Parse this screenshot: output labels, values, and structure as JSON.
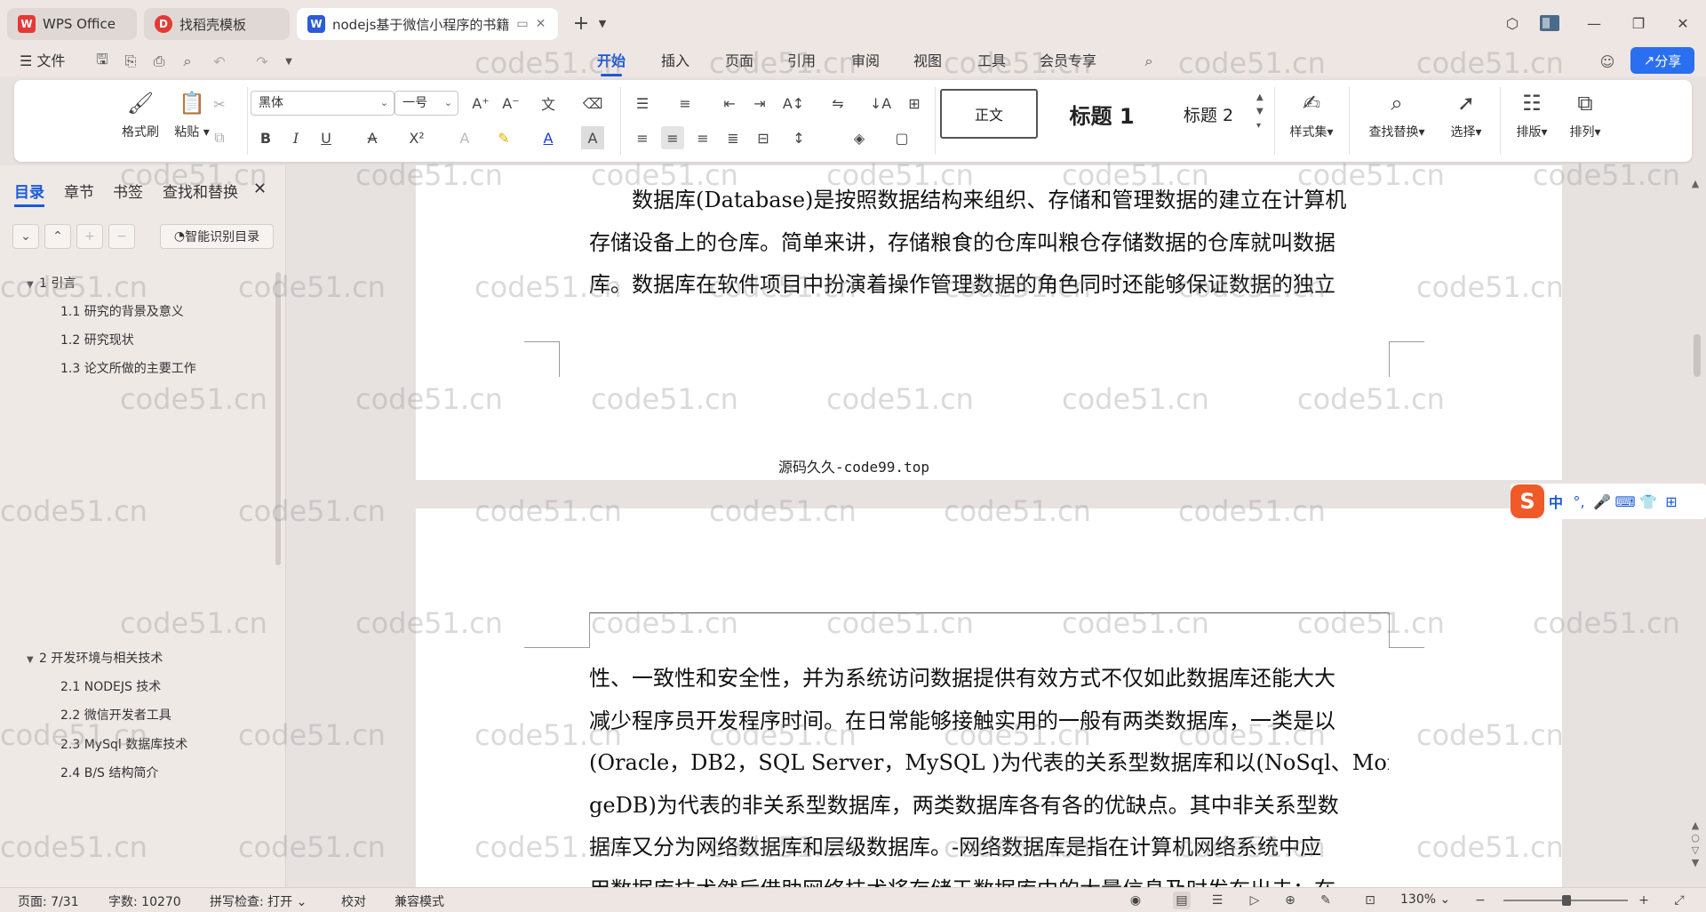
{
  "tabs": [
    {
      "label": "WPS Office",
      "logo": "W",
      "color": "#e53935"
    },
    {
      "label": "找稻壳模板",
      "logo": "D",
      "color": "#e53935"
    },
    {
      "label": "nodejs基于微信小程序的书籍",
      "logo": "W",
      "color": "#2b5bd7"
    }
  ],
  "new_tab_label": "+",
  "menu": {
    "file_label": "文件",
    "items": [
      "开始",
      "插入",
      "页面",
      "引用",
      "审阅",
      "视图",
      "工具",
      "会员专享"
    ],
    "active_index": 0
  },
  "share_label": "分享",
  "ribbon": {
    "format_painter": "格式刷",
    "paste": "粘贴",
    "font_name": "黑体",
    "font_size": "一号",
    "styles": [
      "正文",
      "标题 1",
      "标题 2"
    ],
    "style_set": "样式集",
    "find_replace": "查找替换",
    "select": "选择",
    "layout": "排版",
    "arrange": "排列"
  },
  "nav": {
    "tabs": [
      "目录",
      "章节",
      "书签",
      "查找和替换"
    ],
    "active_tab": 0,
    "smart_toc_label": "智能识别目录",
    "toc": [
      {
        "label": "1  引言",
        "level": 1
      },
      {
        "label": "1.1 研究的背景及意义",
        "level": 2
      },
      {
        "label": "1.2 研究现状",
        "level": 2
      },
      {
        "label": "1.3 论文所做的主要工作",
        "level": 2
      },
      {
        "label": "2  开发环境与相关技术",
        "level": 1
      },
      {
        "label": "2.1 NODEJS 技术",
        "level": 2
      },
      {
        "label": "2.2 微信开发者工具",
        "level": 2
      },
      {
        "label": "2.3 MySql 数据库技术",
        "level": 2
      },
      {
        "label": "2.4 B/S 结构简介",
        "level": 2
      }
    ]
  },
  "document": {
    "page1_lines": [
      "　　数据库(Database)是按照数据结构来组织、存储和管理数据的建立在计算机",
      "存储设备上的仓库。简单来讲，存储粮食的仓库叫粮仓存储数据的仓库就叫数据",
      "库。数据库在软件项目中扮演着操作管理数据的角色同时还能够保证数据的独立"
    ],
    "page1_footer": "源码久久-code99.top",
    "page2_lines": [
      "性、一致性和安全性，并为系统访问数据提供有效方式不仅如此数据库还能大大",
      "减少程序员开发程序时间。在日常能够接触实用的一般有两类数据库，一类是以",
      "(Oracle，DB2，SQL  Server，MySQL  )为代表的关系型数据库和以(NoSql、Mon",
      "geDB)为代表的非关系型数据库，两类数据库各有各的优缺点。其中非关系型数",
      "据库又分为网络数据库和层级数据库。-网络数据库是指在计算机网络系统中应",
      "用数据库技术然后借助网络技术将存储于数据库中的大量信息及时发布出去；在"
    ]
  },
  "watermark": "code51.cn",
  "ime": {
    "lang": "中"
  },
  "status": {
    "page": "页面: 7/31",
    "words": "字数: 10270",
    "spell": "拼写检查: 打开",
    "proof": "校对",
    "compat": "兼容模式",
    "zoom": "130%"
  }
}
